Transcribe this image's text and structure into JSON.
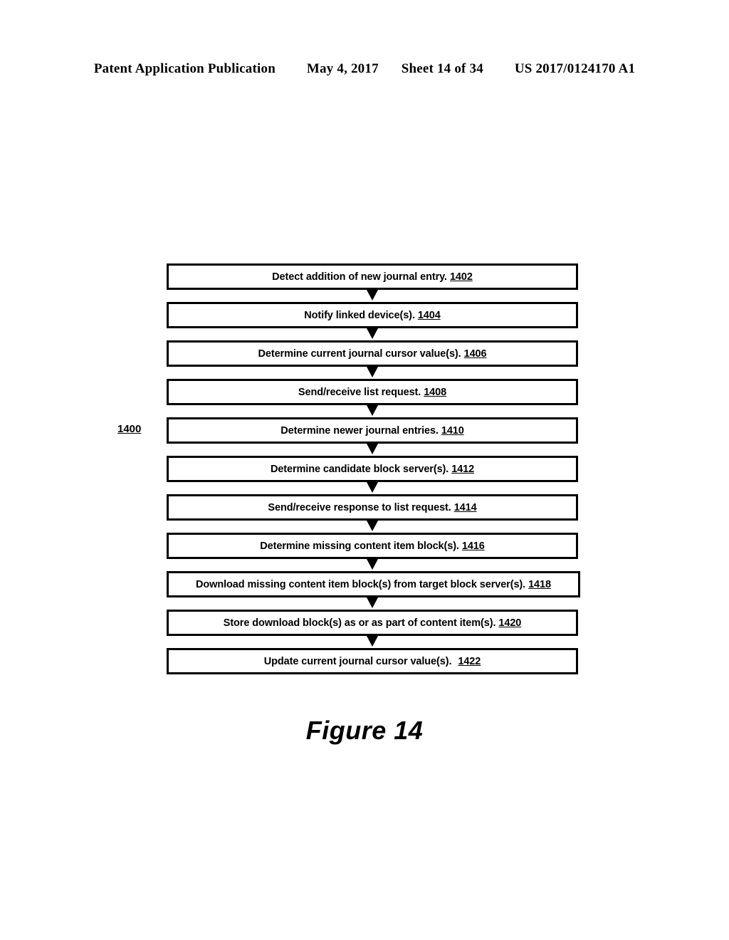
{
  "header": {
    "publication": "Patent Application Publication",
    "date": "May 4, 2017",
    "sheet": "Sheet 14 of 34",
    "number": "US 2017/0124170 A1"
  },
  "figure": {
    "caption": "Figure 14",
    "diagram_ref": "1400"
  },
  "flowchart": {
    "type": "flowchart",
    "orientation": "vertical",
    "connector": "down-arrow",
    "steps": [
      {
        "label": "Detect addition of new journal entry.",
        "ref": "1402",
        "wide": false
      },
      {
        "label": "Notify linked device(s).",
        "ref": "1404",
        "wide": false
      },
      {
        "label": "Determine current journal cursor value(s).",
        "ref": "1406",
        "wide": false
      },
      {
        "label": "Send/receive list request.",
        "ref": "1408",
        "wide": false
      },
      {
        "label": "Determine newer journal entries.",
        "ref": "1410",
        "wide": false
      },
      {
        "label": "Determine candidate block server(s).",
        "ref": "1412",
        "wide": false
      },
      {
        "label": "Send/receive response to list request.",
        "ref": "1414",
        "wide": false
      },
      {
        "label": "Determine missing content item block(s).",
        "ref": "1416",
        "wide": false
      },
      {
        "label": "Download missing content item block(s) from target block server(s).",
        "ref": "1418",
        "wide": true
      },
      {
        "label": "Store download block(s) as or as part of content item(s).",
        "ref": "1420",
        "wide": false
      },
      {
        "label": "Update current journal cursor value(s).",
        "ref": "1422",
        "wide": false,
        "extra_space": true
      }
    ]
  }
}
